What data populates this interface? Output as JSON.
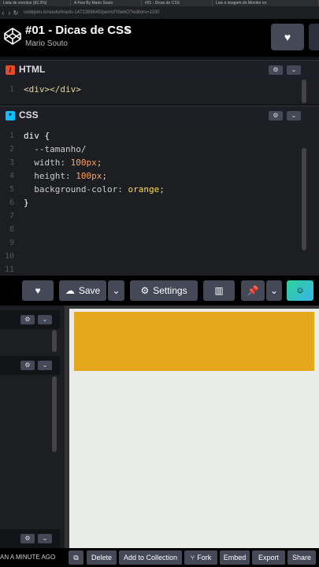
{
  "browser": {
    "tabs": [
      "Lista de eventos (82.3%)",
      "A Few By Mario Souto",
      "#01 - Dicas de CSS",
      "Live a imagem do Monitor en"
    ],
    "url": "codepen.io/souto/mario-1472269645/pen/ofYbebO?editors=1100"
  },
  "header": {
    "title": "#01 - Dicas de CSS",
    "author": "Mario Souto",
    "heart_icon": "♥"
  },
  "html_editor": {
    "label": "HTML",
    "badge_icon": "html-icon",
    "lines": [
      "<div></div>"
    ],
    "line_numbers": [
      "1"
    ]
  },
  "css_editor": {
    "label": "CSS",
    "badge_icon": "css-icon",
    "line_numbers": [
      "1",
      "2",
      "3",
      "4",
      "5",
      "6",
      "7",
      "8",
      "9",
      "10",
      "11"
    ],
    "code": {
      "l1": "div {",
      "l2": "  --tamanho/",
      "l3_prop": "  width: ",
      "l3_val": "100px",
      "l4_prop": "  height: ",
      "l4_val": "100px",
      "l5_prop": "  background-color: ",
      "l5_val": "orange",
      "l6": "}"
    }
  },
  "toolbar": {
    "save_label": "Save",
    "settings_label": "Settings",
    "heart": "♥"
  },
  "footer": {
    "saved_text": "AN A MINUTE AGO",
    "buttons": [
      "Delete",
      "Add to Collection",
      "Fork",
      "Embed",
      "Export",
      "Share"
    ]
  },
  "colors": {
    "preview_box": "#e5a71c",
    "preview_bg": "#e9ebe8",
    "accent_html": "#e34c26",
    "accent_css": "#0ebeff"
  }
}
